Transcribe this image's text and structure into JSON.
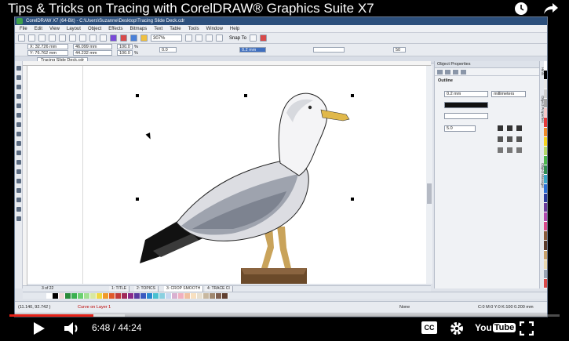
{
  "video": {
    "title": "Tips & Tricks on Tracing with CorelDRAW® Graphics Suite X7",
    "time_current": "6:48",
    "time_separator": "/",
    "time_total": "44:24",
    "progress_fraction": 0.153,
    "buffer_fraction": 0.21,
    "cc_label": "CC",
    "youtube_label": "You",
    "youtube_tube": "Tube"
  },
  "app": {
    "window_title": "CorelDRAW X7 (64-Bit) - C:\\Users\\Suzanne\\Desktop\\Tracing Slide Deck.cdr",
    "menu": [
      "File",
      "Edit",
      "View",
      "Layout",
      "Object",
      "Effects",
      "Bitmaps",
      "Text",
      "Table",
      "Tools",
      "Window",
      "Help"
    ],
    "zoom": "307%",
    "snap_to": "Snap To",
    "doc_tab": "Tracing Slide Deck.cdr",
    "prop": {
      "x": "X: 32.726 mm",
      "y": "Y: 76.762 mm",
      "w": "46.099 mm",
      "h": "44.232 mm",
      "sx": "100.0",
      "sy": "100.0",
      "pct": "%",
      "rot": "0.0",
      "outline": "0.2 mm",
      "num50": "50"
    },
    "pages": {
      "counter": "3 of 22",
      "tabs": [
        "1: TITLE",
        "2: TOPICS",
        "3: CROP SMOOTH",
        "4: TRACE CI"
      ]
    },
    "object_properties": {
      "header": "Object Properties",
      "section": "Outline",
      "width": "0.2 mm",
      "units": "millimeters",
      "miter": "5.0",
      "side_tabs": [
        "Hints",
        "Object Properties",
        "Object Manager"
      ]
    },
    "status": {
      "coords": "(11.140, 92.742 )",
      "layer": "Curve on Layer 1",
      "fill": "None",
      "color": "C:0 M:0 Y:0 K:100  0.200 mm"
    },
    "palette_v": [
      "#ffffff",
      "#000000",
      "#e8e8e8",
      "#cfcfcf",
      "#a8a8a8",
      "#f4c7c7",
      "#e63a3a",
      "#f08a2a",
      "#f5d21f",
      "#b5d96a",
      "#4db84d",
      "#2f8f4f",
      "#3aa7c9",
      "#2a6fd4",
      "#2a3b9c",
      "#6a3b9c",
      "#b04ab0",
      "#d84a8a",
      "#8a5a3a",
      "#5a3a2a",
      "#c7a06a",
      "#e9d8b0",
      "#9aa4b4",
      "#d84a4a"
    ],
    "palette_h": [
      "#ffffff",
      "#000000",
      "#f0d8d8",
      "#2a8a3a",
      "#3ab050",
      "#6ad070",
      "#a0e090",
      "#d8e8a0",
      "#f0d840",
      "#f09a2a",
      "#e05a2a",
      "#c03a3a",
      "#a02a5a",
      "#8a2a8a",
      "#5a3aa0",
      "#3a5ac0",
      "#2a8ad0",
      "#4ac0d0",
      "#8ad0e0",
      "#c8d8f0",
      "#d8b0d0",
      "#f0b0c0",
      "#f0c0a0",
      "#f8e0c0",
      "#e8e0d0",
      "#c8b8a0",
      "#a08870",
      "#806050",
      "#604030"
    ]
  }
}
